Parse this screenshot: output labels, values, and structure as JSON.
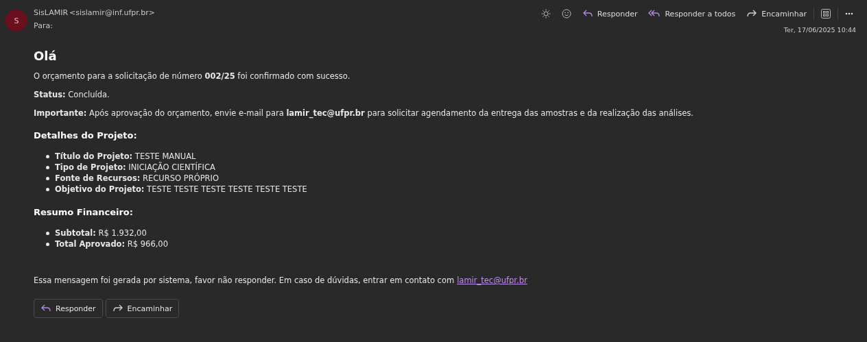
{
  "header": {
    "avatar": "S",
    "sender": "SisLAMIR",
    "sender_email": "<sislamir@inf.ufpr.br>",
    "to_label": "Para:",
    "date": "Ter, 17/06/2025 10:44",
    "toolbar": [
      {
        "kind": "sun"
      },
      {
        "kind": "emoji"
      },
      {
        "kind": "reply",
        "label": "Responder"
      },
      {
        "kind": "reply-all",
        "label": "Responder a todos"
      },
      {
        "kind": "forward",
        "label": "Encaminhar"
      },
      {
        "kind": "grid"
      },
      {
        "kind": "more"
      }
    ]
  },
  "body": {
    "greeting": "Olá",
    "paragraphs": [
      "O orçamento para a solicitação de número **002/25** foi confirmado com sucesso.",
      "**Status:** Concluída.",
      "**Importante:** Após aprovação do orçamento, envie e-mail para **lamir_tec@ufpr.br** para solicitar agendamento da entrega das amostras e da realização das análises."
    ],
    "sections": [
      {
        "title": "Detalhes do Projeto:",
        "items": [
          "**Título do Projeto:** TESTE MANUAL",
          "**Tipo de Projeto:** INICIAÇÃO CIENTÍFICA",
          "**Fonte de Recursos:** RECURSO PRÓPRIO",
          "**Objetivo do Projeto:** TESTE TESTE TESTE TESTE TESTE TESTE"
        ]
      },
      {
        "title": "Resumo Financeiro:",
        "items": [
          "**Subtotal:** R$ 1.932,00",
          "**Total Aprovado:** R$ 966,00"
        ]
      }
    ],
    "footer": {
      "text": "Essa mensagem foi gerada por sistema, favor não responder. Em caso de dúvidas, entrar em contato com",
      "link": "lamir_tec@ufpr.br"
    }
  },
  "actions": [
    {
      "kind": "reply",
      "label": "Responder"
    },
    {
      "kind": "forward",
      "label": "Encaminhar"
    }
  ]
}
